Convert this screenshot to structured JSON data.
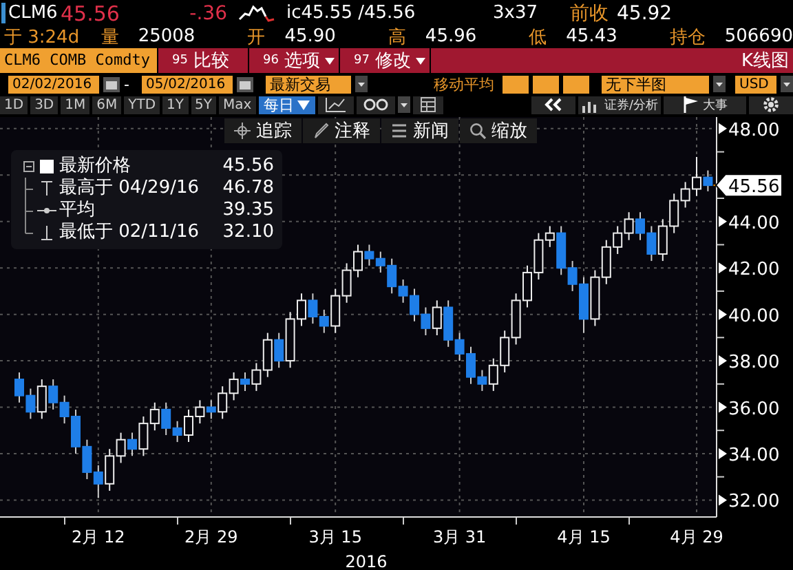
{
  "quote": {
    "ticker": "CLM6",
    "last": "45.56",
    "change": "-.36",
    "bid_ask": "ic45.55 /45.56",
    "size": "3x37",
    "prev_label": "前收",
    "prev": "45.92"
  },
  "stats_row": {
    "time": "于 3:24d",
    "items": [
      {
        "label": "量",
        "value": "25008"
      },
      {
        "label": "开",
        "value": "45.90"
      },
      {
        "label": "高",
        "value": "45.96"
      },
      {
        "label": "低",
        "value": "45.43"
      },
      {
        "label": "持仓",
        "value": "506690"
      }
    ]
  },
  "command_bar": {
    "security": "CLM6 COMB Comdty",
    "actions": [
      {
        "number": "95",
        "label": "比较",
        "dropdown": false
      },
      {
        "number": "96",
        "label": "选项",
        "dropdown": true
      },
      {
        "number": "97",
        "label": "修改",
        "dropdown": true
      }
    ],
    "view_title": "K线图"
  },
  "range_bar": {
    "start": "02/02/2016",
    "separator": "-",
    "end": "05/02/2016",
    "mode": "最新交易",
    "ma_label": "移动平均",
    "lower_chart": "无下半图",
    "currency": "USD"
  },
  "periods": [
    {
      "label": "1D",
      "selected": false
    },
    {
      "label": "3D",
      "selected": false
    },
    {
      "label": "1M",
      "selected": false
    },
    {
      "label": "6M",
      "selected": false
    },
    {
      "label": "YTD",
      "selected": false
    },
    {
      "label": "1Y",
      "selected": false
    },
    {
      "label": "5Y",
      "selected": false
    },
    {
      "label": "Max",
      "selected": false
    }
  ],
  "toolbar": {
    "frequency": "每日",
    "analysis": "证券/分析",
    "events": "大事"
  },
  "chart_tools": [
    {
      "kind": "crosshair",
      "label": "追踪"
    },
    {
      "kind": "pencil",
      "label": "注释"
    },
    {
      "kind": "news",
      "label": "新闻"
    },
    {
      "kind": "zoom",
      "label": "缩放"
    }
  ],
  "legend": [
    {
      "kind": "last",
      "label": "最新价格",
      "value": "45.56"
    },
    {
      "kind": "high",
      "label": "最高于 04/29/16",
      "value": "46.78"
    },
    {
      "kind": "average",
      "label": "平均",
      "value": "39.35"
    },
    {
      "kind": "low",
      "label": "最低于 02/11/16",
      "value": "32.10"
    }
  ],
  "last_price_tag": "45.56",
  "chart_data": {
    "type": "candlestick",
    "grid": true,
    "xlabel": "2016",
    "ylim": [
      31.3,
      48.5
    ],
    "yticks": [
      {
        "value": 32,
        "label": "32.00"
      },
      {
        "value": 34,
        "label": "34.00"
      },
      {
        "value": 36,
        "label": "36.00"
      },
      {
        "value": 38,
        "label": "38.00"
      },
      {
        "value": 40,
        "label": "40.00"
      },
      {
        "value": 42,
        "label": "42.00"
      },
      {
        "value": 44,
        "label": "44.00"
      },
      {
        "value": 48,
        "label": "48.00"
      }
    ],
    "categories": [
      null,
      null,
      null,
      null,
      null,
      null,
      null,
      "2月 12",
      null,
      null,
      null,
      null,
      null,
      null,
      null,
      null,
      null,
      "2月 29",
      null,
      null,
      null,
      null,
      null,
      null,
      null,
      null,
      null,
      null,
      "3月 15",
      null,
      null,
      null,
      null,
      null,
      null,
      null,
      null,
      null,
      null,
      "3月 31",
      null,
      null,
      null,
      null,
      null,
      null,
      null,
      null,
      null,
      null,
      "4月 15",
      null,
      null,
      null,
      null,
      null,
      null,
      null,
      null,
      null,
      "4月 29",
      null
    ],
    "ohlc": [
      [
        37.2,
        37.5,
        36.2,
        36.5
      ],
      [
        36.5,
        36.8,
        35.5,
        35.8
      ],
      [
        35.8,
        37.2,
        35.5,
        36.9
      ],
      [
        36.9,
        37.2,
        35.9,
        36.2
      ],
      [
        36.2,
        36.5,
        35.3,
        35.6
      ],
      [
        35.6,
        35.9,
        34.0,
        34.3
      ],
      [
        34.3,
        34.6,
        32.9,
        33.2
      ],
      [
        33.2,
        33.5,
        32.1,
        32.7
      ],
      [
        32.7,
        34.2,
        32.4,
        33.9
      ],
      [
        33.9,
        34.9,
        33.6,
        34.6
      ],
      [
        34.6,
        34.9,
        33.9,
        34.2
      ],
      [
        34.2,
        35.6,
        33.9,
        35.3
      ],
      [
        35.3,
        36.2,
        35.0,
        35.9
      ],
      [
        35.9,
        36.2,
        34.8,
        35.1
      ],
      [
        35.1,
        35.4,
        34.5,
        34.8
      ],
      [
        34.8,
        35.9,
        34.5,
        35.6
      ],
      [
        35.6,
        36.3,
        35.3,
        36.0
      ],
      [
        36.0,
        36.3,
        35.5,
        35.8
      ],
      [
        35.8,
        36.9,
        35.5,
        36.6
      ],
      [
        36.6,
        37.5,
        36.3,
        37.2
      ],
      [
        37.2,
        37.5,
        36.7,
        37.0
      ],
      [
        37.0,
        37.9,
        36.7,
        37.6
      ],
      [
        37.6,
        39.2,
        37.3,
        38.9
      ],
      [
        38.9,
        39.2,
        37.7,
        38.0
      ],
      [
        38.0,
        40.1,
        37.7,
        39.8
      ],
      [
        39.8,
        40.9,
        39.5,
        40.6
      ],
      [
        40.6,
        40.9,
        39.6,
        39.9
      ],
      [
        39.9,
        40.2,
        39.2,
        39.5
      ],
      [
        39.5,
        41.1,
        39.2,
        40.8
      ],
      [
        40.8,
        42.2,
        40.5,
        41.9
      ],
      [
        41.9,
        43.0,
        41.6,
        42.7
      ],
      [
        42.7,
        43.0,
        42.1,
        42.4
      ],
      [
        42.4,
        42.7,
        41.8,
        42.1
      ],
      [
        42.1,
        42.4,
        40.9,
        41.2
      ],
      [
        41.2,
        41.5,
        40.5,
        40.8
      ],
      [
        40.8,
        41.1,
        39.7,
        40.0
      ],
      [
        40.0,
        40.3,
        39.1,
        39.4
      ],
      [
        39.4,
        40.6,
        39.1,
        40.3
      ],
      [
        40.3,
        40.6,
        38.6,
        38.9
      ],
      [
        38.9,
        39.2,
        38.0,
        38.3
      ],
      [
        38.3,
        38.6,
        37.0,
        37.3
      ],
      [
        37.3,
        37.6,
        36.7,
        37.0
      ],
      [
        37.0,
        38.1,
        36.7,
        37.8
      ],
      [
        37.8,
        39.3,
        37.5,
        39.0
      ],
      [
        39.0,
        40.9,
        38.7,
        40.6
      ],
      [
        40.6,
        42.1,
        40.3,
        41.8
      ],
      [
        41.8,
        43.5,
        41.5,
        43.2
      ],
      [
        43.2,
        43.8,
        42.9,
        43.5
      ],
      [
        43.5,
        43.8,
        41.7,
        42.0
      ],
      [
        42.0,
        42.3,
        41.0,
        41.3
      ],
      [
        41.3,
        41.6,
        39.2,
        39.8
      ],
      [
        39.8,
        41.9,
        39.5,
        41.6
      ],
      [
        41.6,
        43.2,
        41.3,
        42.9
      ],
      [
        42.9,
        43.8,
        42.6,
        43.5
      ],
      [
        43.5,
        44.4,
        43.2,
        44.1
      ],
      [
        44.1,
        44.4,
        43.2,
        43.5
      ],
      [
        43.5,
        43.8,
        42.3,
        42.6
      ],
      [
        42.6,
        44.1,
        42.3,
        43.8
      ],
      [
        43.8,
        45.2,
        43.5,
        44.9
      ],
      [
        44.9,
        45.7,
        44.6,
        45.4
      ],
      [
        45.4,
        46.78,
        45.1,
        45.9
      ],
      [
        45.9,
        46.2,
        45.3,
        45.56
      ]
    ]
  }
}
